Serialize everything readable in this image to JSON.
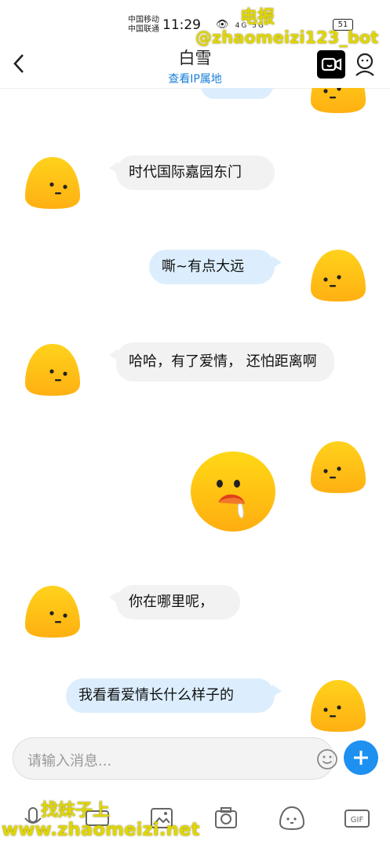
{
  "status_bar": {
    "carrier1": "中国移动",
    "carrier2": "中国联通",
    "time": "11:29",
    "signal_text": "4G 5G",
    "battery": "51"
  },
  "watermarks": {
    "top": "电报",
    "handle": "@zhaomeizi123_bot",
    "bottom1": "找妹子上",
    "bottom2": "www.zhaomeizi.net"
  },
  "header": {
    "title": "白雪",
    "subtitle": "查看IP属地"
  },
  "messages": [
    {
      "side": "in",
      "text": "时代国际嘉园东门"
    },
    {
      "side": "out",
      "text": "嘶~有点大远"
    },
    {
      "side": "in",
      "text": "哈哈，有了爱情， 还怕距离啊"
    },
    {
      "side": "out",
      "type": "sticker",
      "text": ""
    },
    {
      "side": "in",
      "text": "你在哪里呢，"
    },
    {
      "side": "out",
      "text": "我看看爱情长什么样子的"
    }
  ],
  "composer": {
    "placeholder": "请输入消息..."
  },
  "toolbar": [
    "mic-icon",
    "keyboard-icon",
    "image-icon",
    "camera-icon",
    "emoji-icon",
    "gif-icon"
  ],
  "colors": {
    "accent": "#1e90f0",
    "bubble_in": "#f2f2f2",
    "bubble_out": "#dceefd",
    "avatar": "#ffc41a"
  }
}
